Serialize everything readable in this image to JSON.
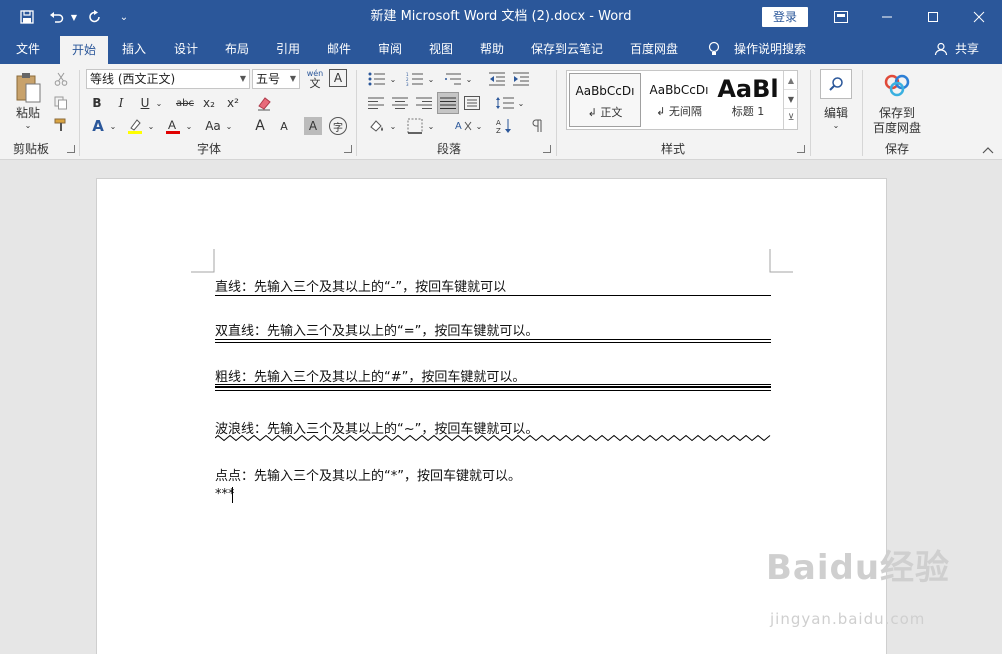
{
  "window": {
    "title": "新建 Microsoft Word 文档 (2).docx  -  Word",
    "login": "登录"
  },
  "tabs": [
    {
      "label": "文件"
    },
    {
      "label": "开始"
    },
    {
      "label": "插入"
    },
    {
      "label": "设计"
    },
    {
      "label": "布局"
    },
    {
      "label": "引用"
    },
    {
      "label": "邮件"
    },
    {
      "label": "审阅"
    },
    {
      "label": "视图"
    },
    {
      "label": "帮助"
    },
    {
      "label": "保存到云笔记"
    },
    {
      "label": "百度网盘"
    },
    {
      "label": "操作说明搜索"
    }
  ],
  "share": "共享",
  "ribbon": {
    "clipboard": {
      "paste": "粘贴",
      "label": "剪贴板"
    },
    "font": {
      "name": "等线 (西文正文)",
      "size": "五号",
      "phonetic": "wén",
      "label": "字体",
      "bold": "B",
      "italic": "I",
      "underline": "U",
      "strike": "abc",
      "subscript": "x₂",
      "superscript": "x²",
      "case": "Aa",
      "grow": "A",
      "shrink": "A",
      "char_shade": "A",
      "enclose": "字"
    },
    "paragraph": {
      "label": "段落"
    },
    "styles": {
      "label": "样式",
      "items": [
        {
          "preview": "AaBbCcDı",
          "name": "↲ 正文"
        },
        {
          "preview": "AaBbCcDı",
          "name": "↲ 无间隔"
        },
        {
          "preview": "AaBl",
          "name": "标题 1"
        }
      ]
    },
    "editing": {
      "label": "编辑"
    },
    "save": {
      "line1": "保存到",
      "line2": "百度网盘",
      "label": "保存"
    }
  },
  "document": {
    "lines": [
      "直线：先输入三个及其以上的“-”，按回车键就可以",
      "双直线：先输入三个及其以上的“=”，按回车键就可以。",
      "粗线：先输入三个及其以上的“#”，按回车键就可以。",
      "波浪线：先输入三个及其以上的“~”，按回车键就可以。",
      "点点：先输入三个及其以上的“*”，按回车键就可以。",
      "***"
    ]
  },
  "watermark": {
    "logo": "Baidu经验",
    "url": "jingyan.baidu.com"
  },
  "colors": {
    "brand": "#2b579a",
    "ribbon_bg": "#f3f3f3",
    "canvas": "#e6e6e6"
  }
}
